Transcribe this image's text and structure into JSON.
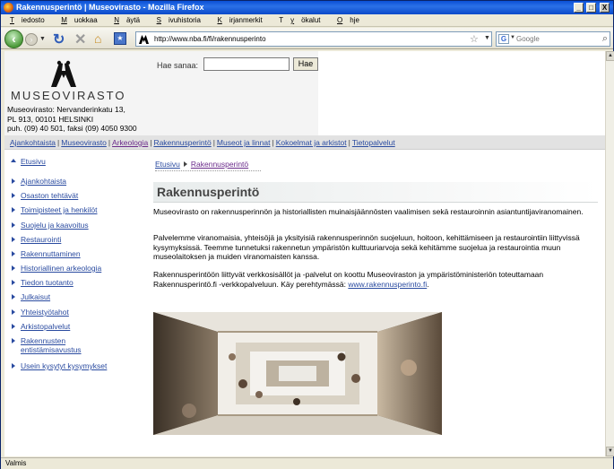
{
  "window": {
    "title": "Rakennusperintö | Museovirasto - Mozilla Firefox",
    "buttons": {
      "minimize": "_",
      "maximize": "□",
      "close": "X"
    }
  },
  "menu": [
    "Tiedosto",
    "Muokkaa",
    "Näytä",
    "Sivuhistoria",
    "Kirjanmerkit",
    "Työkalut",
    "Ohje"
  ],
  "menu_mnemonics": [
    "T",
    "M",
    "N",
    "S",
    "K",
    "y",
    "O"
  ],
  "toolbar": {
    "url": "http://www.nba.fi/fi/rakennusperinto",
    "search_placeholder": "Google",
    "search_engine_glyph": "G"
  },
  "site": {
    "logo_text": "MUSEOVIRASTO",
    "address_lines": [
      "Museovirasto: Nervanderinkatu 13,",
      "PL 913, 00101 HELSINKI",
      "puh. (09) 40 501, faksi (09) 4050 9300"
    ],
    "search_label": "Hae sanaa:",
    "search_button": "Hae",
    "top_nav": [
      {
        "label": "Ajankohtaista",
        "active": false
      },
      {
        "label": "Museovirasto",
        "active": false
      },
      {
        "label": "Arkeologia",
        "active": true
      },
      {
        "label": "Rakennusperintö",
        "active": false
      },
      {
        "label": "Museot ja linnat",
        "active": false
      },
      {
        "label": "Kokoelmat ja arkistot",
        "active": false
      },
      {
        "label": "Tietopalvelut",
        "active": false
      }
    ],
    "top_nav_separator": "|"
  },
  "left_nav": {
    "home": "Etusivu",
    "items": [
      "Ajankohtaista",
      "Osaston tehtävät",
      "Toimipisteet ja henkilöt",
      "Suojelu ja kaavoitus",
      "Restaurointi",
      "Rakennuttaminen",
      "Historiallinen arkeologia",
      "Tiedon tuotanto",
      "Julkaisut",
      "Yhteistyötahot",
      "Arkistopalvelut",
      "Rakennusten entistämisavustus",
      "Usein kysytyt kysymykset"
    ]
  },
  "main": {
    "breadcrumb": [
      "Etusivu",
      "Rakennusperintö"
    ],
    "title": "Rakennusperintö",
    "paragraphs": [
      "Museovirasto on rakennusperinnön ja historiallisten muinaisjäännösten vaalimisen sekä restauroinnin asiantuntijaviranomainen.",
      "Palvelemme viranomaisia, yhteisöjä ja yksityisiä rakennusperinnön suojeluun, hoitoon, kehittämiseen ja restaurointiin liittyvissä kysymyksissä. Teemme tunnetuksi rakennetun ympäristön kulttuuriarvoja sekä kehitämme suojelua ja restaurointia muun museolaitoksen ja muiden viranomaisten kanssa."
    ],
    "para3_text": "Rakennusperintöön liittyvät verkkosisällöt ja -palvelut on koottu Museoviraston ja ympäristöministeriön toteuttamaan Rakennusperintö.fi -verkkopalveluun. Käy perehtymässä:",
    "para3_link": "www.rakennusperinto.fi",
    "para3_end": "."
  },
  "status": "Valmis",
  "colors": {
    "link": "#2a4ba0",
    "visited": "#6a2a8a",
    "titlebar": "#0a4fd6"
  }
}
